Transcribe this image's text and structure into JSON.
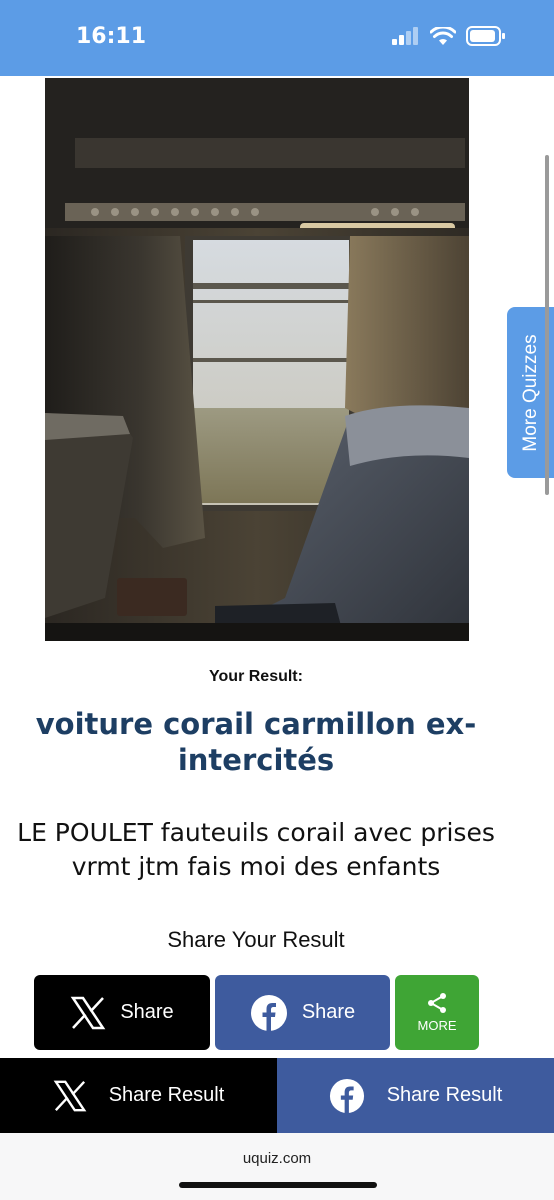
{
  "status": {
    "time": "16:11"
  },
  "result": {
    "label": "Your Result:",
    "title": "voiture corail carmillon ex-intercités",
    "description": "LE POULET fauteuils corail avec prises vrmt jtm fais moi des enfants"
  },
  "share": {
    "heading": "Share Your Result",
    "x_label": "Share",
    "facebook_label": "Share",
    "more_label": "MORE"
  },
  "bottom_bar": {
    "x_label": "Share Result",
    "facebook_label": "Share Result"
  },
  "side_tab": {
    "label": "More Quizzes"
  },
  "browser": {
    "url": "uquiz.com"
  },
  "colors": {
    "accent_blue": "#5c9ce6",
    "title_navy": "#1d3e63",
    "facebook_blue": "#3e5b9e",
    "more_green": "#3fa535",
    "x_black": "#000000"
  },
  "icons": [
    "signal-icon",
    "wifi-icon",
    "battery-icon",
    "x-logo-icon",
    "facebook-icon",
    "share-icon"
  ]
}
